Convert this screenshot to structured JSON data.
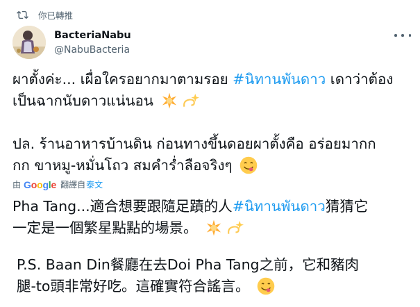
{
  "retweet": {
    "label": "你已轉推"
  },
  "user": {
    "display_name": "BacteriaNabu",
    "handle": "@NabuBacteria"
  },
  "tweet": {
    "line1a": "ผาตั้งค่ะ... เผื่อใครอยากมาตามรอย ",
    "hashtag1": "#นิทานพันดาว",
    "line1b": " เดาว่าต้อง",
    "line2": "เป็นฉากนับดาวแน่นอน",
    "line3": "ปล. ร้านอาหารบ้านดิน ก่อนทางขึ้นดอยผาตั้งคือ อร่อยมากก",
    "line4": "กก ขาหมู-หมั่นโถว สมคำร่ำลือจริงๆ"
  },
  "translation": {
    "by": "由",
    "google": "Google",
    "label": "翻譯自",
    "link": "泰文",
    "line1a": "Pha Tang...適合想要跟隨足蹟的人",
    "hashtag": "#นิทานพันดาว",
    "line1b": "猜猜它",
    "line2": "一定是一個繁星點點的場景。",
    "line3": "P.S. Baan Din餐廳在去Doi Pha Tang之前，它和豬肉",
    "line4": "腿-to頭非常好吃。這確實符合謠言。"
  },
  "icons": {
    "retweet": "retweet-icon",
    "more": "more-options-icon",
    "sparkle": "glowing-star-emoji",
    "dizzy": "dizzy-emoji",
    "yum": "face-savoring-food-emoji"
  },
  "colors": {
    "accent": "#1d9bf0",
    "muted": "#536471",
    "text": "#0f1419"
  }
}
